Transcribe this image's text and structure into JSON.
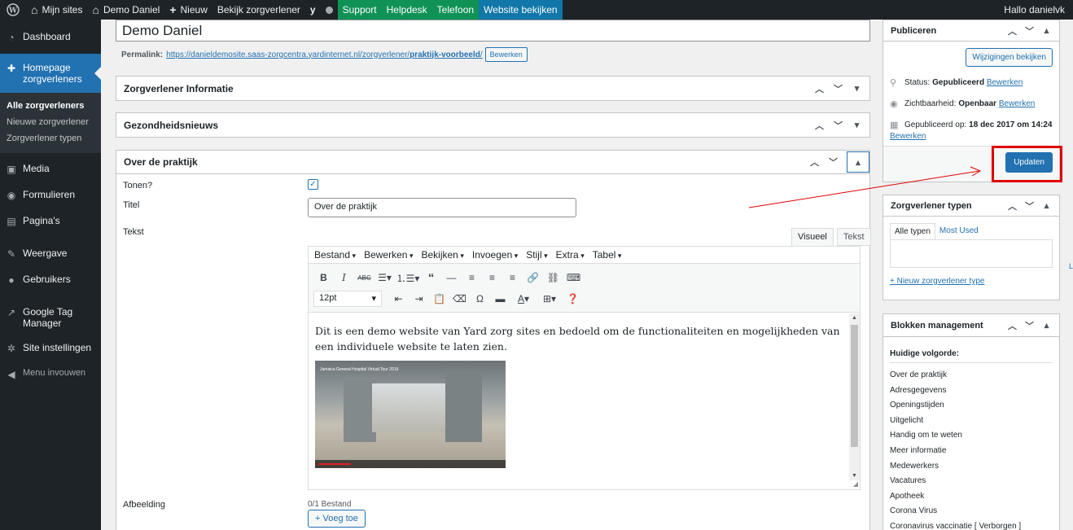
{
  "adminbar": {
    "my_sites": "Mijn sites",
    "site_name": "Demo Daniel",
    "new": "Nieuw",
    "view": "Bekijk zorgverlener",
    "support": "Support",
    "helpdesk": "Helpdesk",
    "telefoon": "Telefoon",
    "website": "Website bekijken",
    "greeting": "Hallo danielvk"
  },
  "sidebar": {
    "dashboard": "Dashboard",
    "current": "Homepage zorgverleners",
    "sub": [
      "Alle zorgverleners",
      "Nieuwe zorgverlener",
      "Zorgverlener typen"
    ],
    "media": "Media",
    "formulieren": "Formulieren",
    "paginas": "Pagina's",
    "weergave": "Weergave",
    "gebruikers": "Gebruikers",
    "gtm": "Google Tag Manager",
    "site_instellingen": "Site instellingen",
    "collapse": "Menu invouwen"
  },
  "post": {
    "title": "Demo Daniel",
    "permalink_label": "Permalink:",
    "permalink_base": "https://danieldemosite.saas-zorgcentra.yardinternet.nl/zorgverlener/",
    "permalink_slug": "praktijk-voorbeeld",
    "permalink_end": "/",
    "edit_btn": "Bewerken"
  },
  "boxes": {
    "info": "Zorgverlener Informatie",
    "news": "Gezondheidsnieuws",
    "about": "Over de praktijk"
  },
  "fields": {
    "tonen": "Tonen?",
    "titel_label": "Titel",
    "titel_value": "Over de praktijk",
    "tekst_label": "Tekst",
    "afbeelding_label": "Afbeelding",
    "afbeelding_count": "0/1 Bestand",
    "add_btn": "+ Voeg toe"
  },
  "editor": {
    "tab_visual": "Visueel",
    "tab_text": "Tekst",
    "menus": [
      "Bestand",
      "Bewerken",
      "Bekijken",
      "Invoegen",
      "Stijl",
      "Extra",
      "Tabel"
    ],
    "font_size": "12pt",
    "content": "Dit is een demo website van Yard zorg sites en bedoeld om de functionaliteiten en mogelijkheden van een individuele website te laten zien.",
    "video_title": "Jamaica General Hospital Virtual Tour 2019"
  },
  "publish": {
    "title": "Publiceren",
    "preview_btn": "Wijzigingen bekijken",
    "status_label": "Status:",
    "status_value": "Gepubliceerd",
    "visibility_label": "Zichtbaarheid:",
    "visibility_value": "Openbaar",
    "published_label": "Gepubliceerd op:",
    "published_value": "18 dec 2017 om 14:24",
    "edit_link": "Bewerken",
    "update_btn": "Updaten"
  },
  "types": {
    "title": "Zorgverlener typen",
    "tab_all": "Alle typen",
    "tab_used": "Most Used",
    "add_link": "+ Nieuw zorgverlener type"
  },
  "blocks": {
    "title": "Blokken management",
    "order_label": "Huidige volgorde:",
    "items": [
      "Over de praktijk",
      "Adresgegevens",
      "Openingstijden",
      "Uitgelicht",
      "Handig om te weten",
      "Meer informatie",
      "Medewerkers",
      "Vacatures",
      "Apotheek",
      "Corona Virus",
      "Coronavirus vaccinatie [ Verborgen ]"
    ]
  },
  "colors": {
    "accent": "#2271b1",
    "highlight": "#e00000",
    "adminbar_bg": "#1d2327"
  }
}
